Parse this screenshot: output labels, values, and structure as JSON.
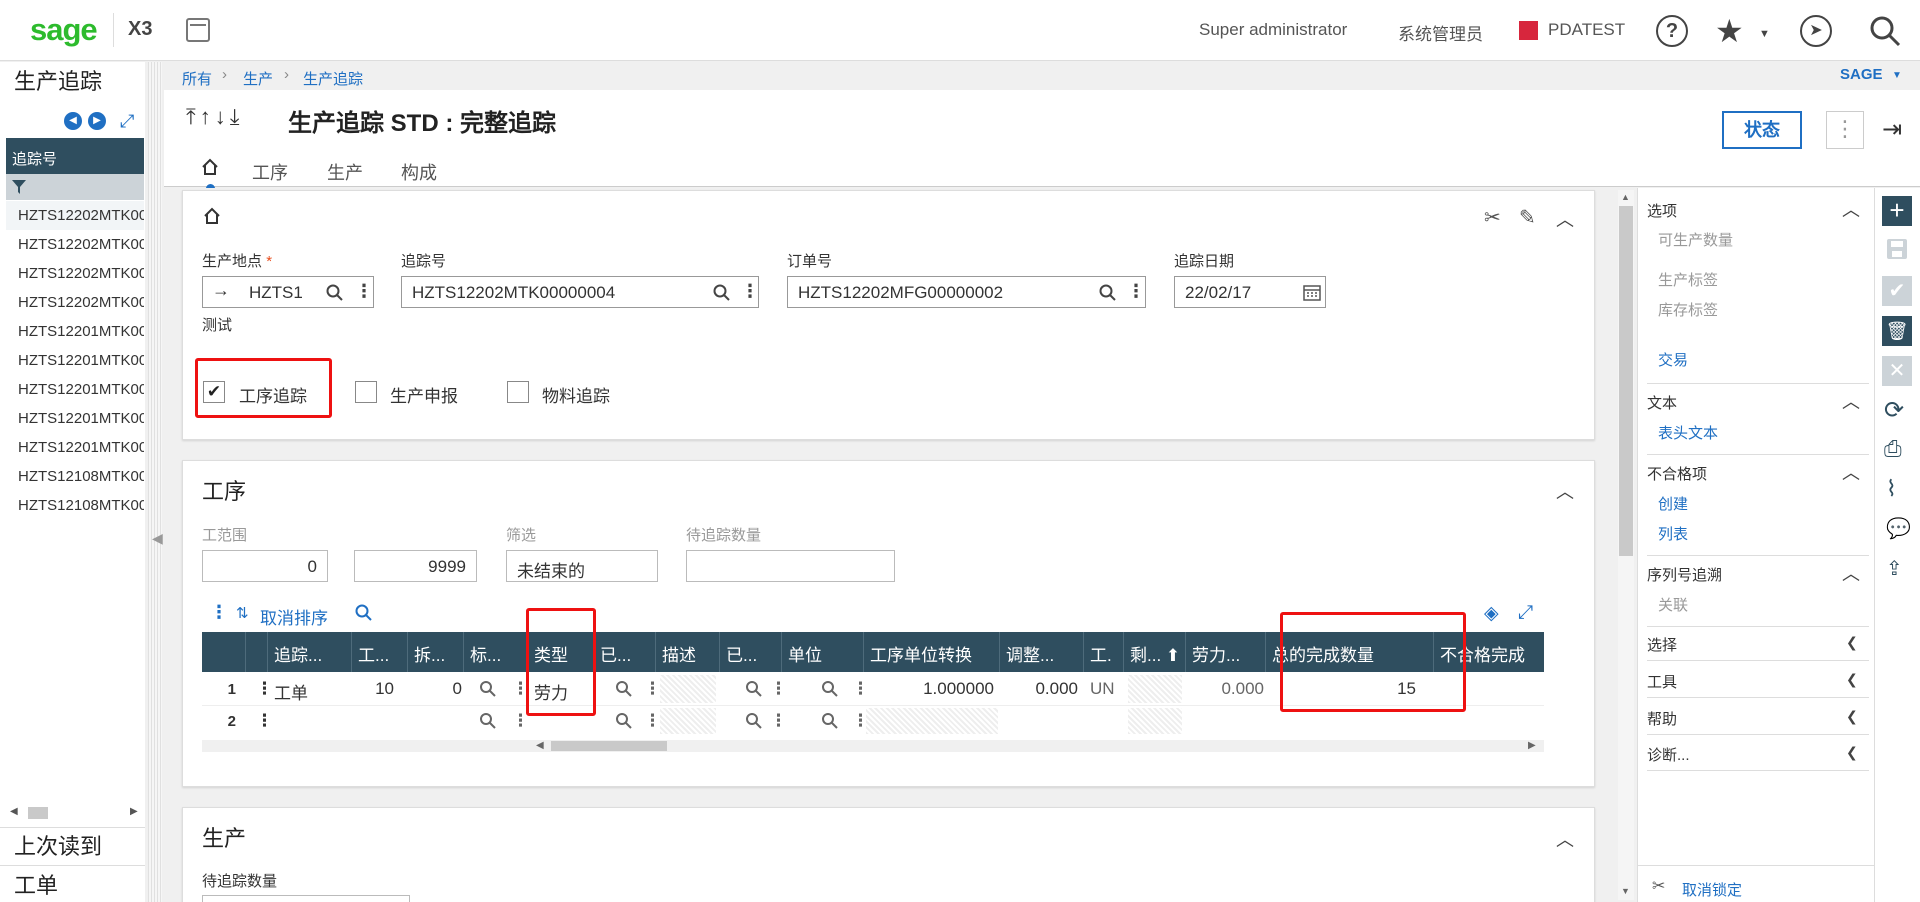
{
  "topbar": {
    "logo": "sage",
    "product": "X3",
    "user": "Super administrator",
    "role": "系统管理员",
    "folder": "PDATEST",
    "folder_color": "#d7263d",
    "help": "?"
  },
  "left": {
    "title": "生产追踪",
    "column": "追踪号",
    "rows": [
      "HZTS12202MTK00",
      "HZTS12202MTK00",
      "HZTS12202MTK00",
      "HZTS12202MTK00",
      "HZTS12201MTK00",
      "HZTS12201MTK00",
      "HZTS12201MTK00",
      "HZTS12201MTK00",
      "HZTS12201MTK00",
      "HZTS12108MTK00",
      "HZTS12108MTK00"
    ],
    "last_read": "上次读到",
    "work_order": "工单"
  },
  "breadcrumb": [
    "所有",
    "生产",
    "生产追踪"
  ],
  "sage_menu": "SAGE",
  "header": {
    "nav_arrows": "⤒↑↓⤓",
    "title": "生产追踪 STD : 完整追踪",
    "status_button": "状态"
  },
  "tabs": [
    "工序",
    "生产",
    "构成"
  ],
  "form": {
    "site_label": "生产地点",
    "site_value": "HZTS1",
    "site_desc": "测试",
    "tracking_label": "追踪号",
    "tracking_value": "HZTS12202MTK00000004",
    "order_label": "订单号",
    "order_value": "HZTS12202MFG00000002",
    "date_label": "追踪日期",
    "date_value": "22/02/17",
    "cb1": "工序追踪",
    "cb2": "生产申报",
    "cb3": "物料追踪"
  },
  "ops": {
    "title": "工序",
    "range_label": "工范围",
    "range_from": "0",
    "range_to": "9999",
    "filter_label": "筛选",
    "filter_value": "未结束的",
    "pending_label": "待追踪数量",
    "pending_value": "",
    "unsort": "取消排序"
  },
  "grid": {
    "headers": [
      "追踪...",
      "工...",
      "拆...",
      "标...",
      "类型",
      "已...",
      "描述",
      "已...",
      "单位",
      "工序单位转换",
      "调整...",
      "工.",
      "剩... ⬆",
      "劳力...",
      "总的完成数量",
      "不合格完成"
    ],
    "row1": [
      "1",
      "工单",
      "10",
      "0",
      "劳力",
      "1.000000",
      "0.000",
      "UN",
      "0.000",
      "15"
    ],
    "row2": [
      "2"
    ]
  },
  "prod": {
    "title": "生产",
    "pending_label": "待追踪数量"
  },
  "right": {
    "options": "选项",
    "producible_qty": "可生产数量",
    "prod_label": "生产标签",
    "stock_label": "库存标签",
    "transaction": "交易",
    "text": "文本",
    "header_text": "表头文本",
    "nonconf": "不合格项",
    "create": "创建",
    "list": "列表",
    "serial": "序列号追溯",
    "related": "关联",
    "select": "选择",
    "tools": "工具",
    "help": "帮助",
    "diagnose": "诊断...",
    "unlock": "取消锁定"
  }
}
